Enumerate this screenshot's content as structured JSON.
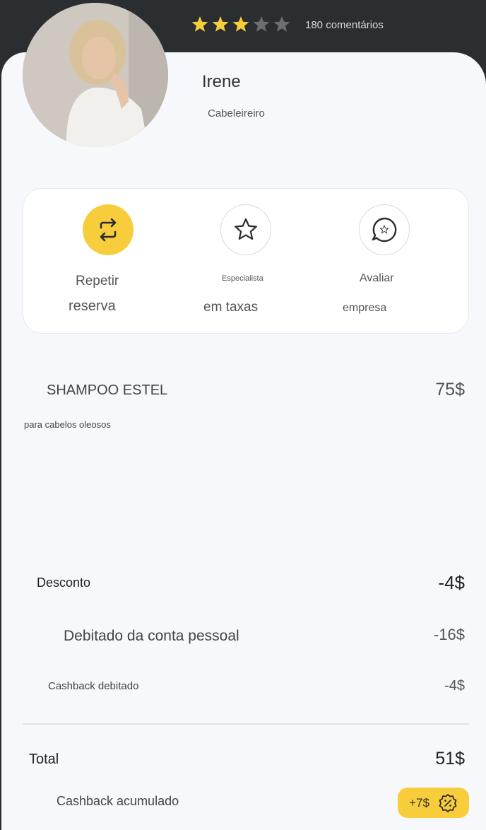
{
  "profile": {
    "rating": 3,
    "rating_max": 5,
    "reviews": "180 comentários",
    "name": "Irene",
    "profession": "Cabeleireiro"
  },
  "actions": [
    {
      "line1": "Repetir",
      "line2": "reserva",
      "icon": "repeat-icon"
    },
    {
      "line1": "Especialista",
      "line2": "em taxas",
      "icon": "star-icon"
    },
    {
      "line1": "Avaliar",
      "line2": "empresa",
      "icon": "review-chat-icon"
    }
  ],
  "product": {
    "name": "SHAMPOO ESTEL",
    "price": "75$",
    "description": "para cabelos oleosos"
  },
  "summary": {
    "discount_label": "Desconto",
    "discount_value": "-4$",
    "personal_label": "Debitado da conta pessoal",
    "personal_value": "-16$",
    "cashback_label": "Cashback debitado",
    "cashback_value": "-4$",
    "total_label": "Total",
    "total_value": "51$",
    "accrued_label": "Cashback acumulado",
    "accrued_value": "+7$"
  },
  "colors": {
    "accent": "#f8cd3b",
    "header": "#2b2e31",
    "background": "#f7f8fc",
    "star_inactive": "#6b6f75"
  }
}
